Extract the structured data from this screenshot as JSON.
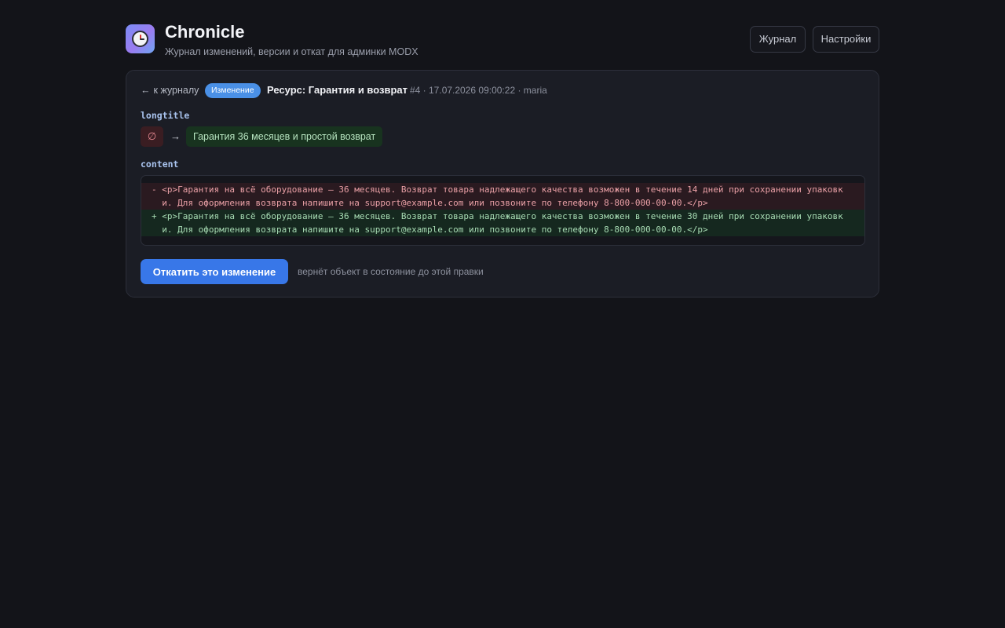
{
  "app": {
    "title": "Chronicle",
    "subtitle": "Журнал изменений, версии и откат для админки MODX",
    "logo_icon": "clock-icon"
  },
  "nav": {
    "journal_label": "Журнал",
    "settings_label": "Настройки"
  },
  "entry": {
    "back_arrow": "←",
    "back_label": "к журналу",
    "badge": "Изменение",
    "resource_title": "Ресурс: Гарантия и возврат",
    "meta": "#4 · 17.07.2026 09:00:22 · maria",
    "fields": [
      {
        "name": "longtitle",
        "old_value": "∅",
        "arrow": "→",
        "new_value": "Гарантия 36 месяцев и простой возврат"
      },
      {
        "name": "content",
        "diff": {
          "removed": "- <p>Гарантия на всё оборудование — 36 месяцев. Возврат товара надлежащего качества возможен в течение 14 дней при сохранении упаковк\n  и. Для оформления возврата напишите на support@example.com или позвоните по телефону 8-800-000-00-00.</p>",
          "added": "+ <p>Гарантия на всё оборудование — 36 месяцев. Возврат товара надлежащего качества возможен в течение 30 дней при сохранении упаковк\n  и. Для оформления возврата напишите на support@example.com или позвоните по телефону 8-800-000-00-00.</p>"
        }
      }
    ],
    "rollback_label": "Откатить это изменение",
    "rollback_hint": "вернёт объект в состояние до этой правки"
  },
  "colors": {
    "background": "#131419",
    "card": "#1b1d25",
    "accent": "#3877e8",
    "badge": "#4a90e6",
    "removed": "#eaa0a6",
    "added": "#a8dcb4"
  }
}
